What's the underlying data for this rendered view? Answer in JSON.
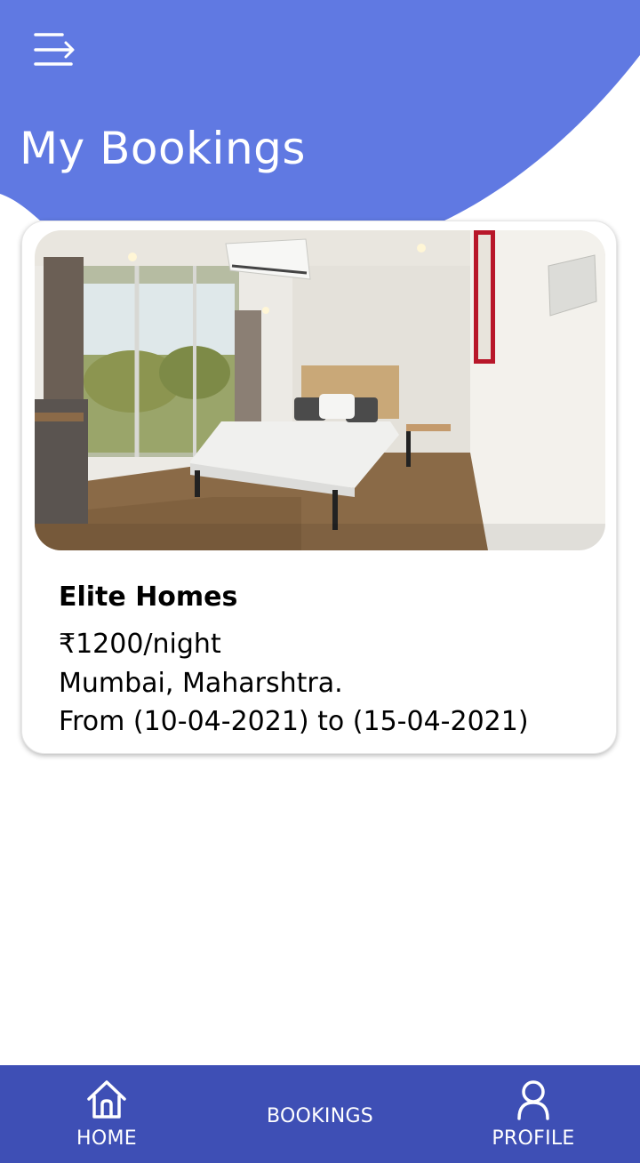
{
  "colors": {
    "header": "#6079e2",
    "nav_bar": "#3e4fb5",
    "text": "#000000",
    "on_primary": "#ffffff"
  },
  "header": {
    "menu_icon": "menu-arrow-icon",
    "title": "My Bookings"
  },
  "booking": {
    "image_icon": "hotel-room-photo",
    "name": "Elite Homes",
    "price": "₹1200/night",
    "location": "Mumbai, Maharshtra.",
    "dates": "From (10-04-2021) to (15-04-2021)"
  },
  "bottom_nav": {
    "items": [
      {
        "label": "HOME",
        "icon": "home-icon"
      },
      {
        "label": "BOOKINGS",
        "icon": ""
      },
      {
        "label": "PROFILE",
        "icon": "person-icon"
      }
    ]
  }
}
